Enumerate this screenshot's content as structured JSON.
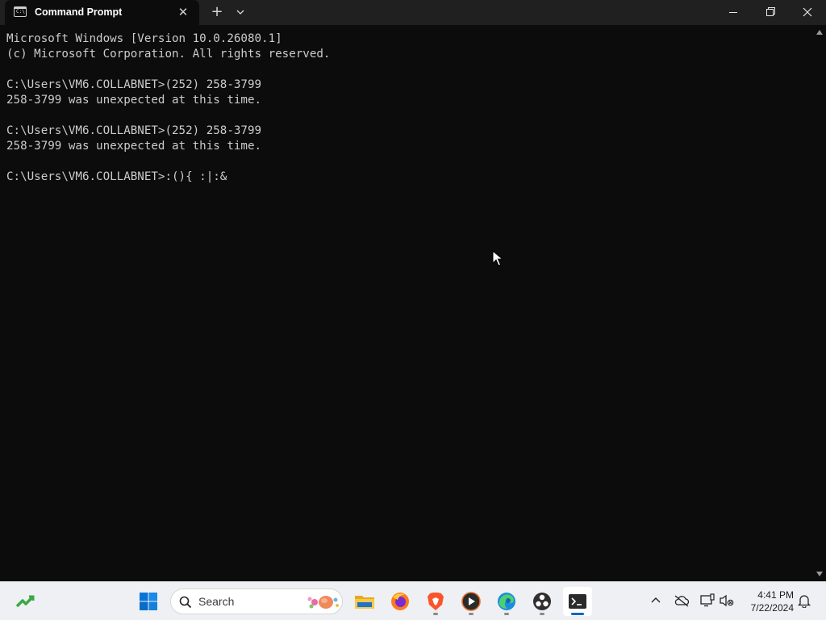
{
  "window": {
    "tab_title": "Command Prompt",
    "tab_icon_text": "C:\\",
    "close_tab_glyph": "✕",
    "new_tab_glyph": "+"
  },
  "terminal": {
    "lines": [
      "Microsoft Windows [Version 10.0.26080.1]",
      "(c) Microsoft Corporation. All rights reserved.",
      "",
      "C:\\Users\\VM6.COLLABNET>(252) 258-3799",
      "258-3799 was unexpected at this time.",
      "",
      "C:\\Users\\VM6.COLLABNET>(252) 258-3799",
      "258-3799 was unexpected at this time.",
      "",
      "C:\\Users\\VM6.COLLABNET>:(){ :|:&"
    ]
  },
  "taskbar": {
    "search_placeholder": "Search",
    "apps": [
      {
        "name": "Start",
        "icon": "windows-start-icon"
      },
      {
        "name": "File Explorer",
        "icon": "folder-icon"
      },
      {
        "name": "Firefox",
        "icon": "firefox-icon"
      },
      {
        "name": "Brave",
        "icon": "brave-icon"
      },
      {
        "name": "Media Player",
        "icon": "media-player-icon"
      },
      {
        "name": "Edge",
        "icon": "edge-icon"
      },
      {
        "name": "OBS",
        "icon": "obs-icon"
      },
      {
        "name": "Terminal",
        "icon": "terminal-icon"
      }
    ]
  },
  "clock": {
    "time": "4:41 PM",
    "date": "7/22/2024"
  },
  "colors": {
    "terminal_bg": "#0c0c0c",
    "terminal_fg": "#cccccc",
    "titlebar_bg": "#202020",
    "taskbar_bg": "#eef0f3",
    "accent": "#0067c0"
  }
}
